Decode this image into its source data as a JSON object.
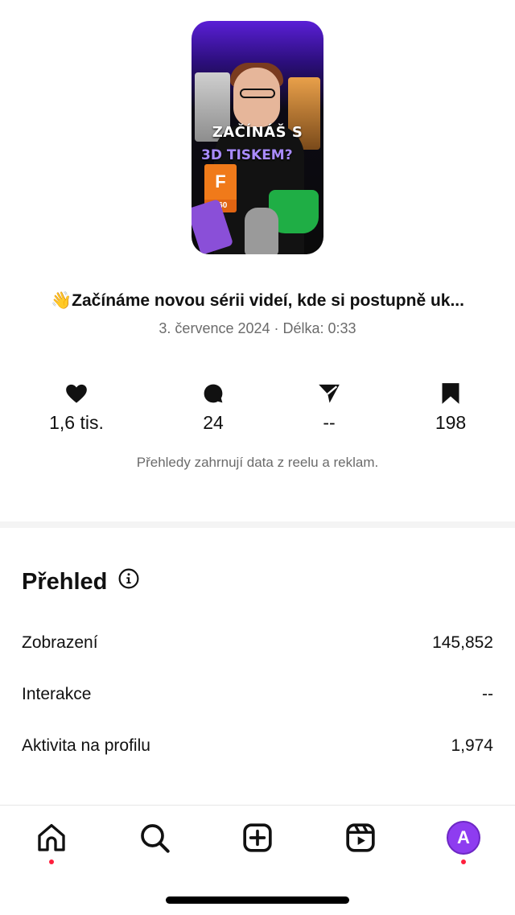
{
  "thumbnail": {
    "title_line1": "ZAČÍNÁŠ S",
    "title_line2": "3D TISKEM?",
    "logo_letter": "F",
    "logo_number": "360"
  },
  "post": {
    "emoji": "👋",
    "caption": "Začínáme novou sérii videí, kde si postupně uk...",
    "meta": "3. července 2024 · Délka: 0:33"
  },
  "stats": [
    {
      "icon": "heart-icon",
      "value": "1,6 tis."
    },
    {
      "icon": "comment-icon",
      "value": "24"
    },
    {
      "icon": "share-icon",
      "value": "--"
    },
    {
      "icon": "bookmark-icon",
      "value": "198"
    }
  ],
  "stats_note": "Přehledy zahrnují data z reelu a reklam.",
  "overview": {
    "title": "Přehled",
    "rows": [
      {
        "label": "Zobrazení",
        "value": "145,852"
      },
      {
        "label": "Interakce",
        "value": "--"
      },
      {
        "label": "Aktivita na profilu",
        "value": "1,974"
      }
    ]
  },
  "nav": {
    "items": [
      "home-icon",
      "search-icon",
      "create-icon",
      "reels-icon",
      "profile-avatar"
    ],
    "avatar_letter": "A",
    "badge_color": "#ff1f3d",
    "avatar_color": "#8e3cf0"
  }
}
